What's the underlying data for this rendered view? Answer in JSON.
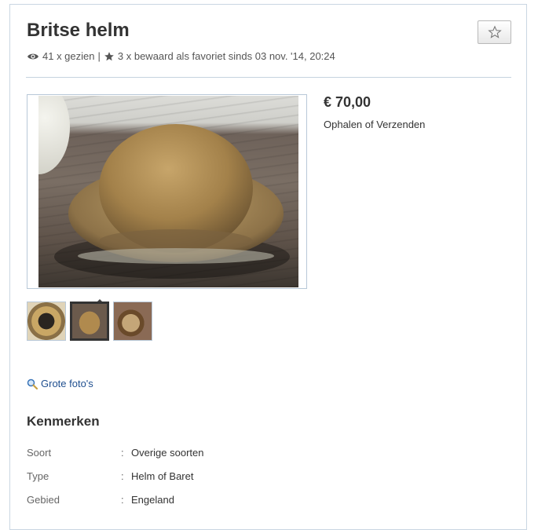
{
  "listing": {
    "title": "Britse helm",
    "views": "41 x gezien",
    "separator": "|",
    "favorites": "3 x bewaard als favoriet sinds 03 nov. '14, 20:24",
    "price": "€ 70,00",
    "delivery": "Ophalen of Verzenden",
    "large_photos_link": "Grote foto's"
  },
  "icons": {
    "views": "eye-icon",
    "favorites": "star-icon",
    "favorite_button": "star-outline-icon",
    "large_photos": "magnifier-icon"
  },
  "gallery": {
    "selected_index": 1,
    "thumbnail_count": 3
  },
  "specs": {
    "heading": "Kenmerken",
    "rows": [
      {
        "label": "Soort",
        "colon": ":",
        "value": "Overige soorten"
      },
      {
        "label": "Type",
        "colon": ":",
        "value": "Helm of Baret"
      },
      {
        "label": "Gebied",
        "colon": ":",
        "value": "Engeland"
      }
    ]
  },
  "colors": {
    "link": "#1f4f8f",
    "border": "#c9d6e2",
    "text": "#333333"
  }
}
